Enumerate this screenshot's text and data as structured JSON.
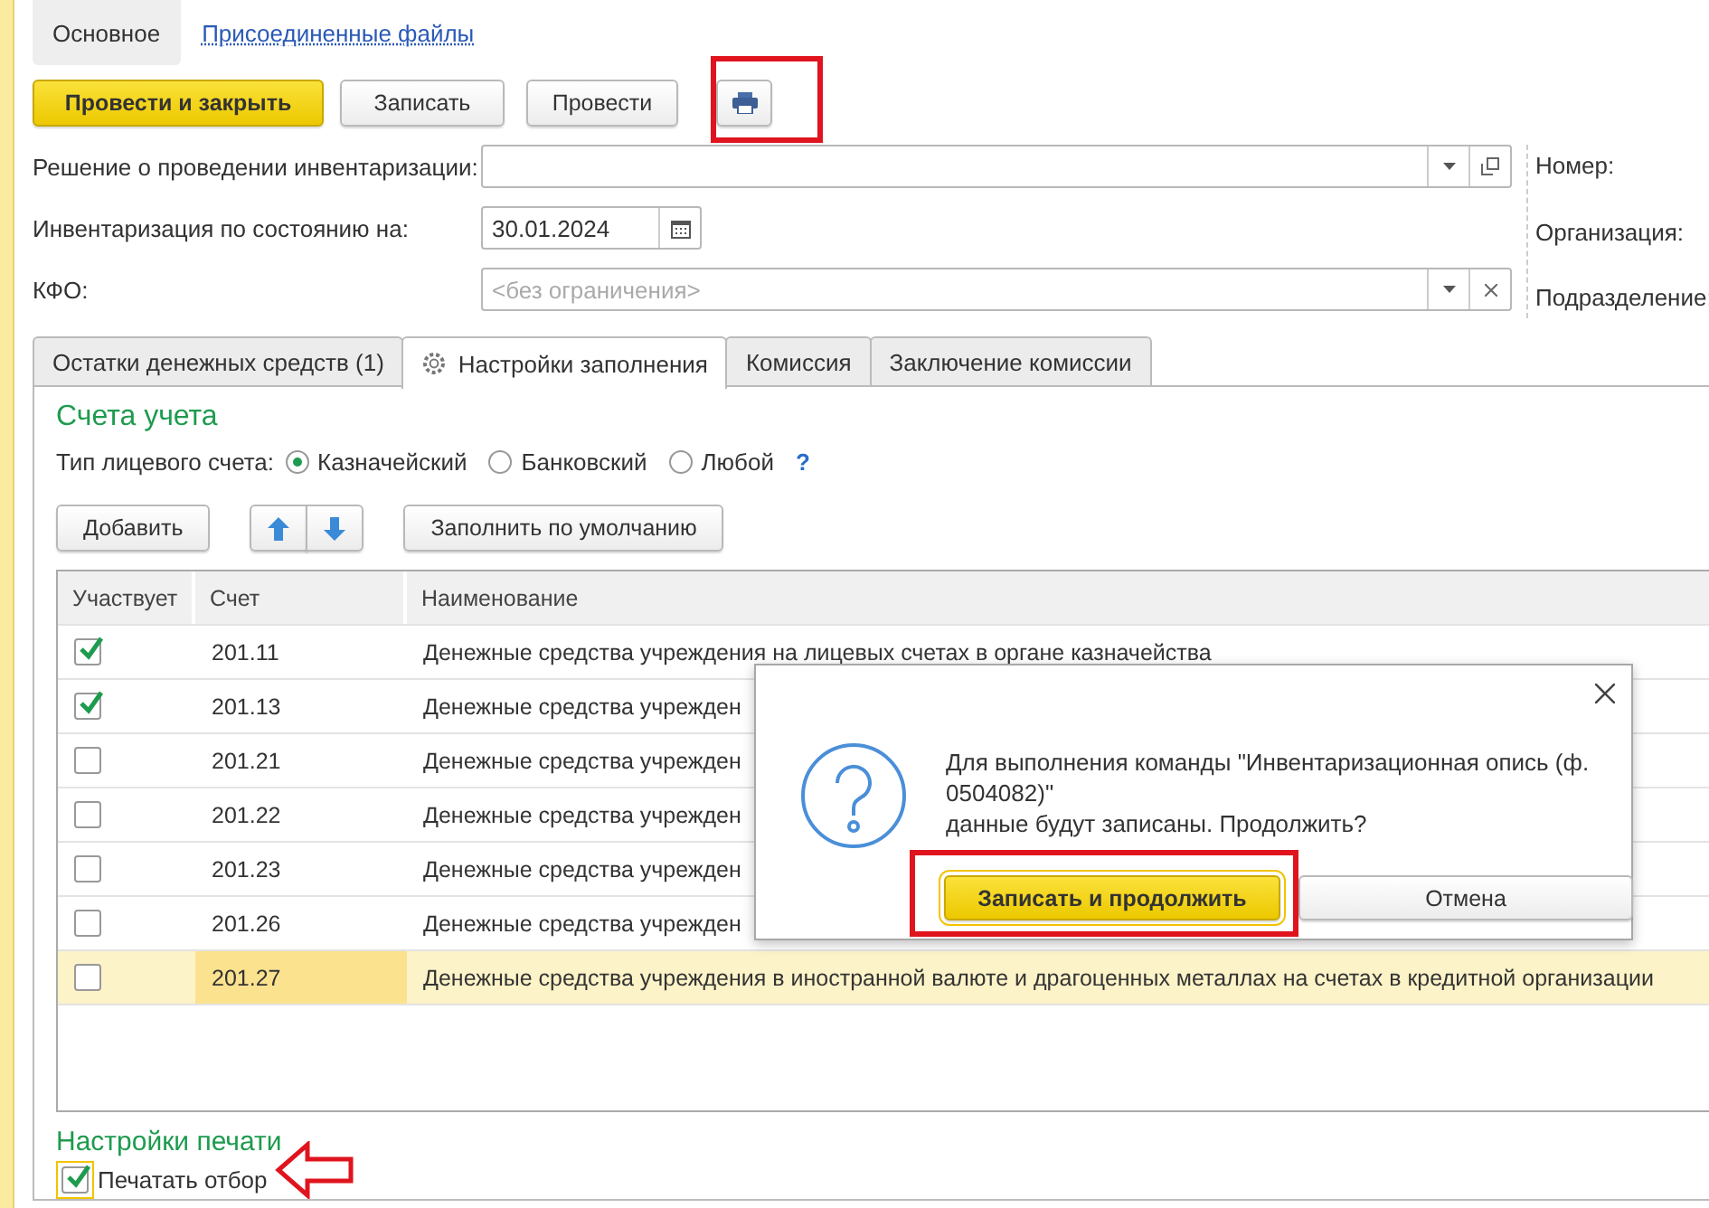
{
  "form_tabs": [
    {
      "label": "Основное",
      "selected": true,
      "kind": "tab"
    },
    {
      "label": "Присоединенные файлы",
      "selected": false,
      "kind": "link"
    }
  ],
  "command_bar": [
    {
      "label": "Провести и закрыть",
      "kind": "primary"
    },
    {
      "label": "Записать",
      "kind": "normal"
    },
    {
      "label": "Провести",
      "kind": "normal"
    },
    {
      "kind": "print"
    }
  ],
  "fields": [
    {
      "label": "Решение о проведении инвентаризации:",
      "kind": "reference"
    },
    {
      "label": "Инвентаризация по состоянию на:",
      "kind": "date",
      "value": "30.01.2024"
    },
    {
      "label": "КФО:",
      "kind": "choice",
      "placeholder": "<без ограничения>"
    }
  ],
  "header_fields": [
    "Номер:",
    "Организация:",
    "Подразделение:"
  ],
  "tabs": [
    {
      "label": "Остатки денежных средств (1)",
      "selected": false,
      "icon": false
    },
    {
      "label": "Настройки заполнения",
      "selected": true,
      "icon": true
    },
    {
      "label": "Комиссия",
      "selected": false,
      "icon": false
    },
    {
      "label": "Заключение комиссии",
      "selected": false,
      "icon": false
    }
  ],
  "accounts_section": {
    "title": "Счета учета",
    "account_type_label": "Тип лицевого счета:",
    "account_types": [
      {
        "label": "Казначейский",
        "selected": true
      },
      {
        "label": "Банковский",
        "selected": false
      },
      {
        "label": "Любой",
        "selected": false
      }
    ],
    "help": "?",
    "toolbar": [
      {
        "kind": "text",
        "label": "Добавить"
      },
      {
        "kind": "move"
      },
      {
        "kind": "text",
        "label": "Заполнить по умолчанию"
      }
    ]
  },
  "table": {
    "columns": [
      "Участвует",
      "Счет",
      "Наименование"
    ],
    "rows": [
      {
        "checked": true,
        "account": "201.11",
        "name": "Денежные средства учреждения на лицевых счетах в органе казначейства",
        "selected": false
      },
      {
        "checked": true,
        "account": "201.13",
        "name": "Денежные средства учрежден",
        "selected": false
      },
      {
        "checked": false,
        "account": "201.21",
        "name": "Денежные средства учрежден",
        "selected": false
      },
      {
        "checked": false,
        "account": "201.22",
        "name": "Денежные средства учрежден",
        "selected": false
      },
      {
        "checked": false,
        "account": "201.23",
        "name": "Денежные средства учрежден",
        "selected": false
      },
      {
        "checked": false,
        "account": "201.26",
        "name": "Денежные средства учрежден",
        "selected": false
      },
      {
        "checked": false,
        "account": "201.27",
        "name": "Денежные средства учреждения в иностранной валюте и драгоценных металлах на счетах в кредитной организации",
        "selected": true
      }
    ]
  },
  "print_settings": {
    "title": "Настройки печати",
    "option": {
      "label": "Печатать отбор",
      "checked": true
    }
  },
  "dialog": {
    "message_lines": [
      "Для выполнения команды \"Инвентаризационная опись (ф.",
      "0504082)\"",
      "данные будут записаны. Продолжить?"
    ],
    "buttons": [
      {
        "label": "Записать и продолжить",
        "kind": "primary"
      },
      {
        "label": "Отмена",
        "kind": "normal"
      }
    ]
  }
}
